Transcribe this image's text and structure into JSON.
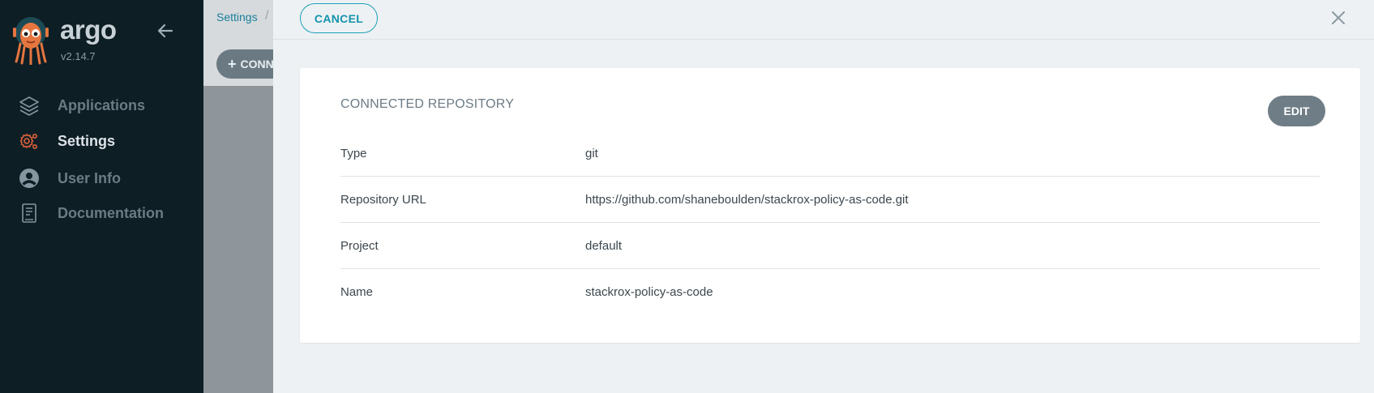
{
  "app": {
    "name": "argo",
    "version": "v2.14.7"
  },
  "sidebar": {
    "items": [
      {
        "label": "Applications",
        "icon": "layers-icon"
      },
      {
        "label": "Settings",
        "icon": "gear-icon",
        "active": true
      },
      {
        "label": "User Info",
        "icon": "user-icon"
      },
      {
        "label": "Documentation",
        "icon": "book-icon"
      }
    ]
  },
  "background": {
    "breadcrumb": "Settings",
    "breadcrumb_sep": "/",
    "connect_label": "CONNECT"
  },
  "panel": {
    "cancel_label": "CANCEL",
    "card": {
      "title": "CONNECTED REPOSITORY",
      "edit_label": "EDIT",
      "rows": [
        {
          "key": "Type",
          "value": "git"
        },
        {
          "key": "Repository URL",
          "value": "https://github.com/shaneboulden/stackrox-policy-as-code.git"
        },
        {
          "key": "Project",
          "value": "default"
        },
        {
          "key": "Name",
          "value": "stackrox-policy-as-code"
        }
      ]
    }
  },
  "colors": {
    "sidebar_bg": "#0e1e25",
    "accent": "#1aa1b8",
    "settings_active": "#e0623a",
    "edit_button": "#6f7d86"
  }
}
